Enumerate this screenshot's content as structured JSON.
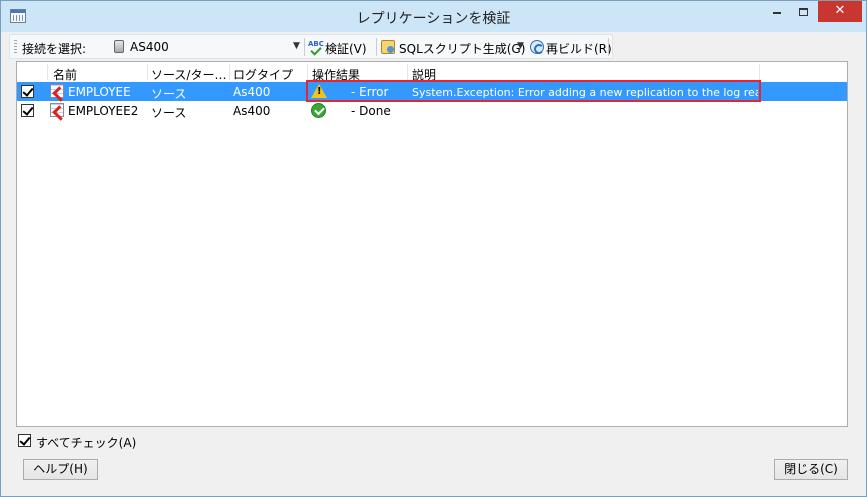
{
  "window": {
    "title": "レプリケーションを検証",
    "close_glyph": "✕"
  },
  "toolbar": {
    "connection_label": "接続を選択:",
    "connection_value": "AS400",
    "verify_label": "検証(V)",
    "sql_label": "SQLスクリプト生成(G)",
    "rebuild_label": "再ビルド(R)"
  },
  "grid": {
    "headers": [
      "名前",
      "ソース/ター…",
      "ログタイプ",
      "操作結果",
      "説明"
    ],
    "rows": [
      {
        "checked": true,
        "name": "EMPLOYEE",
        "source_target": "ソース",
        "log_type": "As400",
        "status_icon": "warning-icon",
        "result": "- Error",
        "description": "System.Exception: Error adding a new replication to the log read…"
      },
      {
        "checked": true,
        "name": "EMPLOYEE2",
        "source_target": "ソース",
        "log_type": "As400",
        "status_icon": "success-icon",
        "result": "- Done",
        "description": ""
      }
    ]
  },
  "footer": {
    "check_all_label": "すべてチェック(A)",
    "help_label": "ヘルプ(H)",
    "close_label": "閉じる(C)"
  },
  "colors": {
    "selection": "#3399ff",
    "highlight": "#e8242e",
    "titlebar": "#cde6f7",
    "close_button": "#c7372f"
  }
}
